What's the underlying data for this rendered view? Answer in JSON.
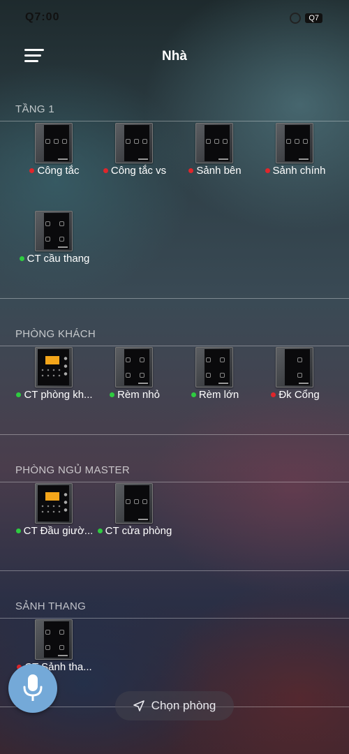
{
  "status_bar": {
    "time": "Q7:00",
    "battery": "Q7"
  },
  "header": {
    "title": "Nhà"
  },
  "sections": [
    {
      "title": "TẦNG 1",
      "devices": [
        {
          "label": "Công tắc",
          "status_color": "#e0262b",
          "thumb": "switch3"
        },
        {
          "label": "Công tắc vs",
          "status_color": "#e0262b",
          "thumb": "switch3"
        },
        {
          "label": "Sảnh bên",
          "status_color": "#e0262b",
          "thumb": "switch3"
        },
        {
          "label": "Sảnh chính",
          "status_color": "#e0262b",
          "thumb": "switch3"
        },
        {
          "label": "CT cầu thang",
          "status_color": "#2ecc40",
          "thumb": "switch4"
        }
      ]
    },
    {
      "title": "PHÒNG KHÁCH",
      "devices": [
        {
          "label": "CT phòng kh...",
          "status_color": "#2ecc40",
          "thumb": "lcd"
        },
        {
          "label": "Rèm nhỏ",
          "status_color": "#2ecc40",
          "thumb": "switch4"
        },
        {
          "label": "Rèm lớn",
          "status_color": "#2ecc40",
          "thumb": "switch4"
        },
        {
          "label": "Đk Cổng",
          "status_color": "#e0262b",
          "thumb": "switch2"
        }
      ]
    },
    {
      "title": "PHÒNG NGỦ MASTER",
      "devices": [
        {
          "label": "CT Đầu giườ...",
          "status_color": "#2ecc40",
          "thumb": "lcd"
        },
        {
          "label": "CT cửa phòng",
          "status_color": "#2ecc40",
          "thumb": "switch3"
        }
      ]
    },
    {
      "title": "SẢNH THANG",
      "devices": [
        {
          "label": "CT Sảnh tha...",
          "status_color": "#e0262b",
          "thumb": "switch4"
        }
      ]
    }
  ],
  "bottom": {
    "choose_room_label": "Chọn phòng",
    "mic_icon": "mic-icon",
    "nav_icon": "location-arrow-icon"
  }
}
